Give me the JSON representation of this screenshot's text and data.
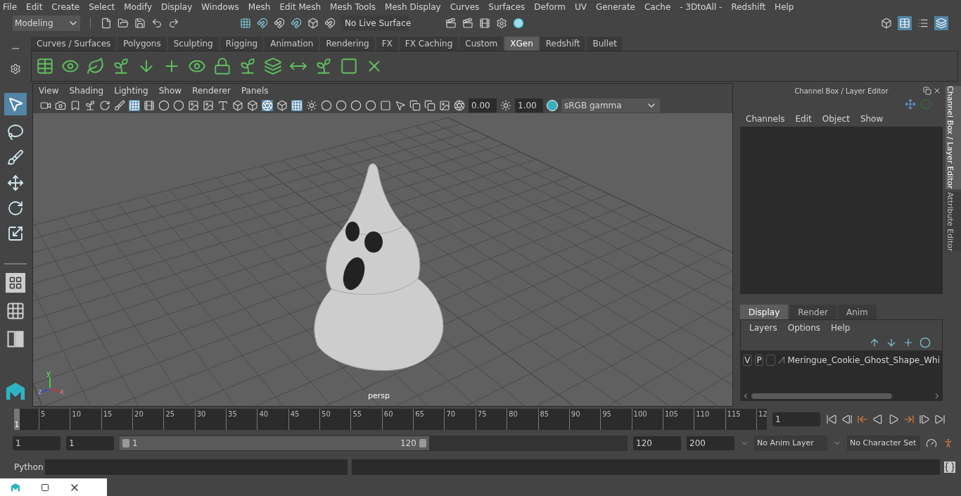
{
  "menu_bar": [
    "File",
    "Edit",
    "Create",
    "Select",
    "Modify",
    "Display",
    "Windows",
    "Mesh",
    "Edit Mesh",
    "Mesh Tools",
    "Mesh Display",
    "Curves",
    "Surfaces",
    "Deform",
    "UV",
    "Generate",
    "Cache",
    "- 3DtoAll -",
    "Redshift",
    "Help"
  ],
  "status_line": {
    "mode": "Modeling",
    "live_surface": "No Live Surface"
  },
  "shelf": {
    "tabs": [
      {
        "label": "Curves / Surfaces",
        "selected": false
      },
      {
        "label": "Polygons",
        "selected": false
      },
      {
        "label": "Sculpting",
        "selected": false
      },
      {
        "label": "Rigging",
        "selected": false
      },
      {
        "label": "Animation",
        "selected": false
      },
      {
        "label": "Rendering",
        "selected": false
      },
      {
        "label": "FX",
        "selected": false
      },
      {
        "label": "FX Caching",
        "selected": false
      },
      {
        "label": "Custom",
        "selected": false
      },
      {
        "label": "XGen",
        "selected": true
      },
      {
        "label": "Redshift",
        "selected": false
      },
      {
        "label": "Bullet",
        "selected": false
      }
    ]
  },
  "viewport": {
    "menus": [
      "View",
      "Shading",
      "Lighting",
      "Show",
      "Renderer",
      "Panels"
    ],
    "exposure": "0.00",
    "gamma": "1.00",
    "color_space": "sRGB gamma",
    "camera": "persp",
    "axis_labels": [
      "y",
      "z",
      "x"
    ]
  },
  "channel_box": {
    "title": "Channel Box / Layer Editor",
    "menus": [
      "Channels",
      "Edit",
      "Object",
      "Show"
    ]
  },
  "layer_editor": {
    "tabs": [
      {
        "label": "Display",
        "selected": true
      },
      {
        "label": "Render",
        "selected": false
      },
      {
        "label": "Anim",
        "selected": false
      }
    ],
    "menus": [
      "Layers",
      "Options",
      "Help"
    ],
    "layers": [
      {
        "visible": "V",
        "playback": "P",
        "name": "Meringue_Cookie_Ghost_Shape_Whi"
      }
    ]
  },
  "side_tabs": [
    {
      "label": "Channel Box / Layer Editor",
      "selected": true
    },
    {
      "label": "Attribute Editor",
      "selected": false
    }
  ],
  "time_slider": {
    "start_label": "1",
    "ticks": [
      "5",
      "10",
      "15",
      "20",
      "25",
      "30",
      "35",
      "40",
      "45",
      "50",
      "55",
      "60",
      "65",
      "70",
      "75",
      "80",
      "85",
      "90",
      "95",
      "100",
      "105",
      "110",
      "115",
      "12"
    ],
    "current_frame": "1"
  },
  "range_slider": {
    "start": "1",
    "playback_start": "1",
    "range_start": "1",
    "range_end": "120",
    "playback_end": "120",
    "end": "200",
    "anim_layer": "No Anim Layer",
    "character_set": "No Character Set"
  },
  "command_line": {
    "language": "Python"
  }
}
